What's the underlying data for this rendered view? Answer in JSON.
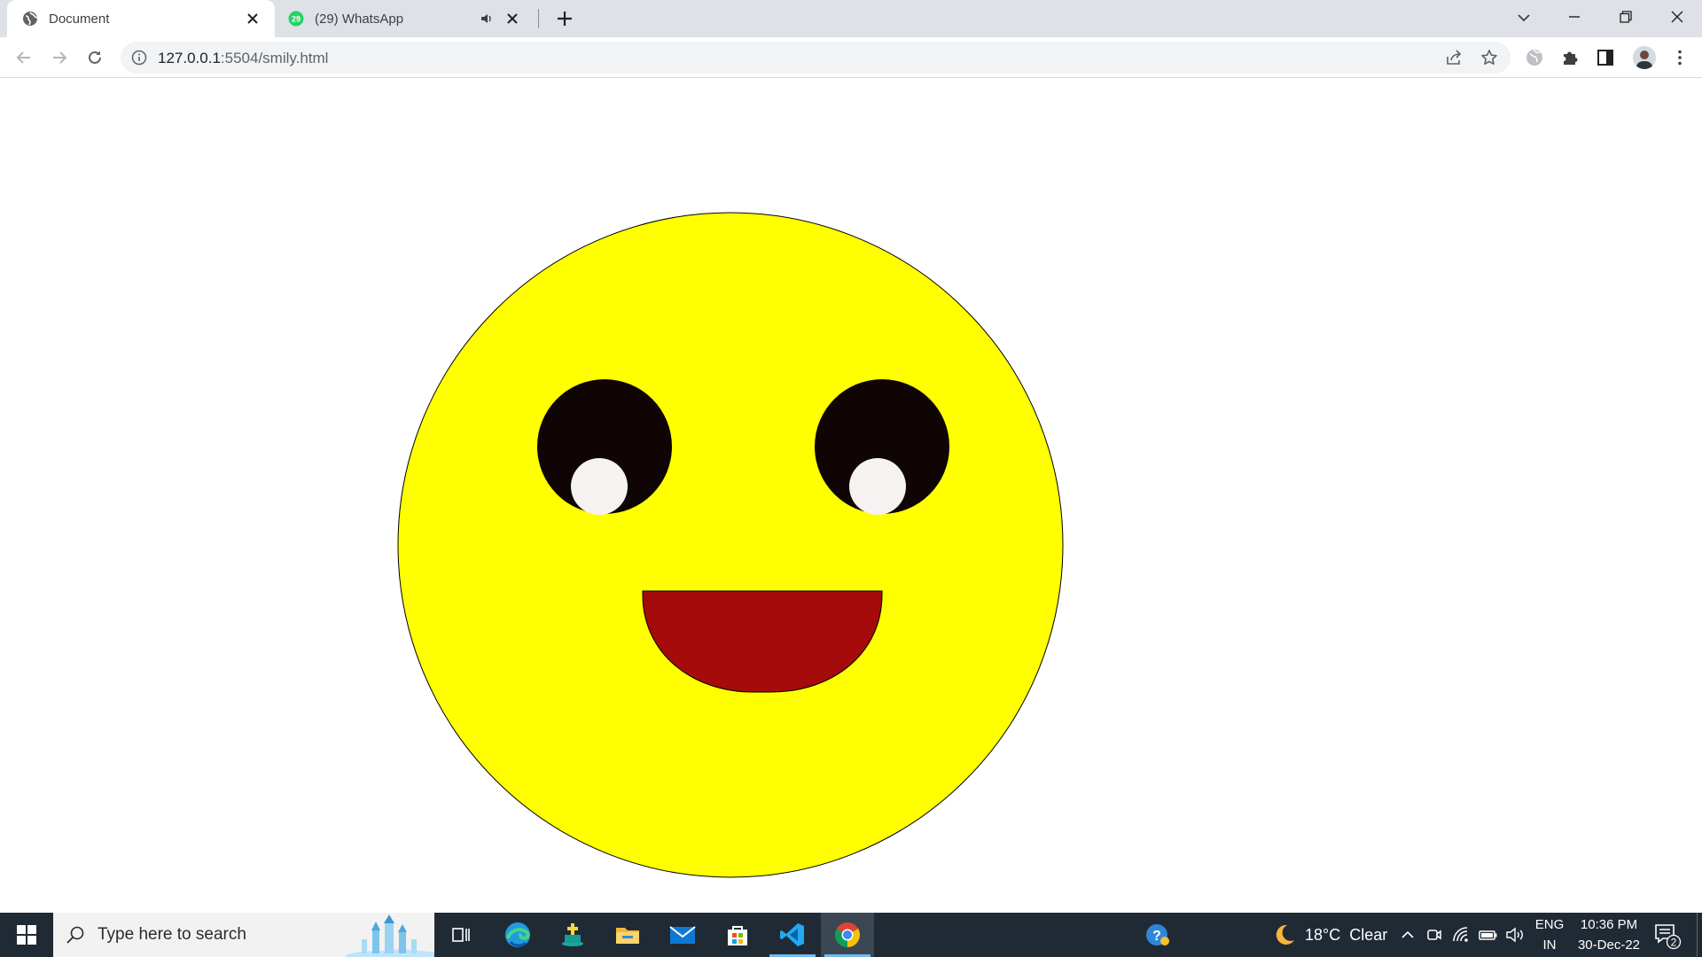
{
  "browser": {
    "tabs": [
      {
        "title": "Document",
        "favicon": "globe-icon",
        "active": true
      },
      {
        "title": "(29) WhatsApp",
        "favicon": "whatsapp-icon",
        "badge": "29",
        "audio": true,
        "active": false
      }
    ],
    "address": {
      "host": "127.0.0.1",
      "rest": ":5504/smily.html"
    }
  },
  "page": {
    "smiley": {
      "face_color": "#ffff00",
      "eye_color": "#0f0505",
      "pupil_highlight_color": "#f7f2f2",
      "mouth_color": "#a50b0b"
    }
  },
  "taskbar": {
    "search_placeholder": "Type here to search",
    "apps": [
      "task-view-icon",
      "edge-icon",
      "store-app-icon",
      "file-explorer-icon",
      "mail-icon",
      "microsoft-store-icon",
      "vscode-icon",
      "chrome-icon"
    ],
    "weather": {
      "temp": "18°C",
      "condition": "Clear"
    },
    "language": {
      "lang": "ENG",
      "region": "IN"
    },
    "clock": {
      "time": "10:36 PM",
      "date": "30-Dec-22"
    },
    "notifications": "2"
  }
}
